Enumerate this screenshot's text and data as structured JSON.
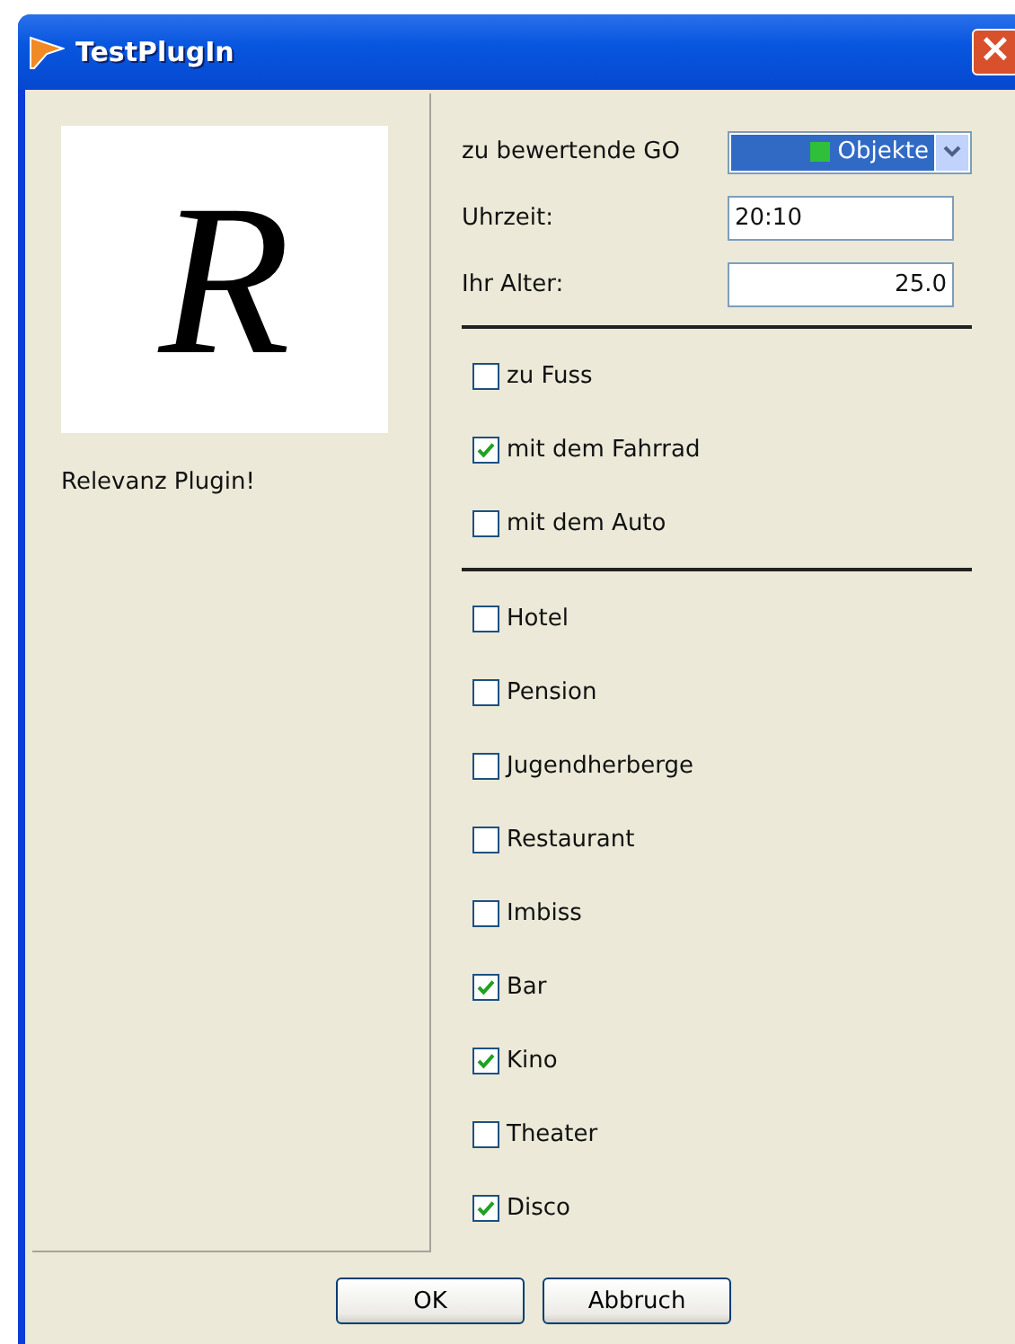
{
  "window": {
    "title": "TestPlugIn",
    "close": "×"
  },
  "left": {
    "logo": "R",
    "caption": "Relevanz Plugin!"
  },
  "fields": [
    {
      "kind": "combo",
      "label": "zu bewertende GO",
      "value": "Objekte",
      "color": "#2fbf3a"
    },
    {
      "kind": "text",
      "label": "Uhrzeit:",
      "value": "20:10",
      "right_aligned": false
    },
    {
      "kind": "text",
      "label": "Ihr Alter:",
      "value": "25.0",
      "right_aligned": true
    }
  ],
  "groups": [
    [
      {
        "label": "zu Fuss",
        "checked": false
      },
      {
        "label": "mit dem Fahrrad",
        "checked": true
      },
      {
        "label": "mit dem Auto",
        "checked": false
      }
    ],
    [
      {
        "label": "Hotel",
        "checked": false
      },
      {
        "label": "Pension",
        "checked": false
      },
      {
        "label": "Jugendherberge",
        "checked": false
      },
      {
        "label": "Restaurant",
        "checked": false
      },
      {
        "label": "Imbiss",
        "checked": false
      },
      {
        "label": "Bar",
        "checked": true
      },
      {
        "label": "Kino",
        "checked": true
      },
      {
        "label": "Theater",
        "checked": false
      },
      {
        "label": "Disco",
        "checked": true
      }
    ]
  ],
  "buttons": [
    "OK",
    "Abbruch"
  ]
}
